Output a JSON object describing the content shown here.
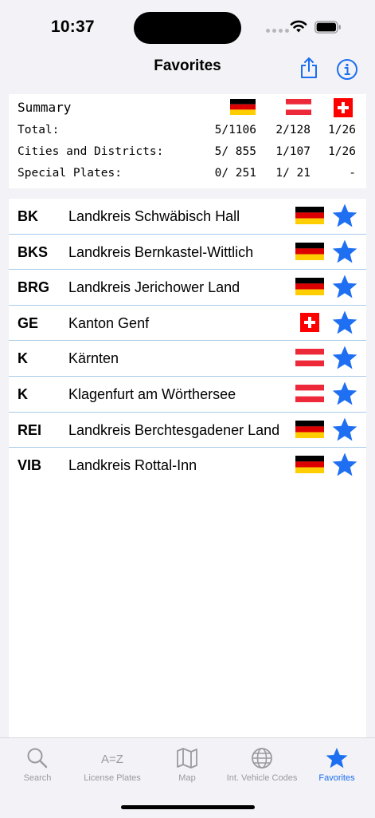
{
  "status_bar": {
    "time": "10:37"
  },
  "nav": {
    "title": "Favorites"
  },
  "summary": {
    "title": "Summary",
    "rows": [
      {
        "label": "Total:",
        "de": "5/1106",
        "at": "2/128",
        "ch": "1/26"
      },
      {
        "label": "Cities and Districts:",
        "de": "5/ 855",
        "at": "1/107",
        "ch": "1/26"
      },
      {
        "label": "Special Plates:",
        "de": "0/ 251",
        "at": "1/ 21",
        "ch": "-"
      }
    ]
  },
  "favorites": [
    {
      "code": "BK",
      "name": "Landkreis Schwäbisch Hall",
      "country": "de"
    },
    {
      "code": "BKS",
      "name": "Landkreis Bernkastel-Wittlich",
      "country": "de"
    },
    {
      "code": "BRG",
      "name": "Landkreis Jerichower Land",
      "country": "de"
    },
    {
      "code": "GE",
      "name": "Kanton Genf",
      "country": "ch"
    },
    {
      "code": "K",
      "name": "Kärnten",
      "country": "at"
    },
    {
      "code": "K",
      "name": "Klagenfurt am Wörthersee",
      "country": "at"
    },
    {
      "code": "REI",
      "name": "Landkreis Berchtesgadener Land",
      "country": "de"
    },
    {
      "code": "VIB",
      "name": "Landkreis Rottal-Inn",
      "country": "de"
    }
  ],
  "tabs": [
    {
      "label": "Search",
      "icon": "search-icon",
      "active": false
    },
    {
      "label": "License Plates",
      "icon": "a-z-icon",
      "active": false
    },
    {
      "label": "Map",
      "icon": "map-icon",
      "active": false
    },
    {
      "label": "Int. Vehicle Codes",
      "icon": "globe-icon",
      "active": false
    },
    {
      "label": "Favorites",
      "icon": "star-icon",
      "active": true
    }
  ],
  "colors": {
    "accent": "#1c6ff0",
    "star": "#1f6ff2",
    "separator": "#a9cbe9"
  }
}
